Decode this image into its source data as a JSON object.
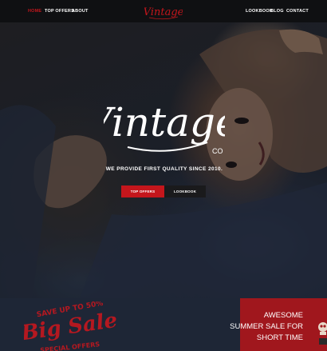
{
  "nav": {
    "left": [
      {
        "label": "HOME",
        "active": true
      },
      {
        "label": "TOP OFFERS",
        "active": false
      },
      {
        "label": "ABOUT",
        "active": false
      }
    ],
    "right": [
      {
        "label": "LOOKBOOK"
      },
      {
        "label": "BLOG"
      },
      {
        "label": "CONTACT"
      }
    ],
    "logo_text": "Vintage"
  },
  "hero": {
    "logo_text": "Vintage",
    "logo_suffix": "CO",
    "tagline": "WE PROVIDE FIRST QUALITY SINCE 2010.",
    "primary_button": "TOP OFFERS",
    "secondary_button": "LOOKBOOK"
  },
  "promo": {
    "badge_top": "SAVE UP TO 50%",
    "badge_main": "Big Sale",
    "badge_bottom": "SPECIAL OFFERS",
    "panel_lines": [
      "AWESOME",
      "SUMMER SALE FOR",
      "SHORT TIME"
    ]
  },
  "colors": {
    "accent": "#c4161c",
    "nav_bg": "#0f1012",
    "promo_bg": "#1e2636",
    "panel_bg": "#a0171d"
  }
}
